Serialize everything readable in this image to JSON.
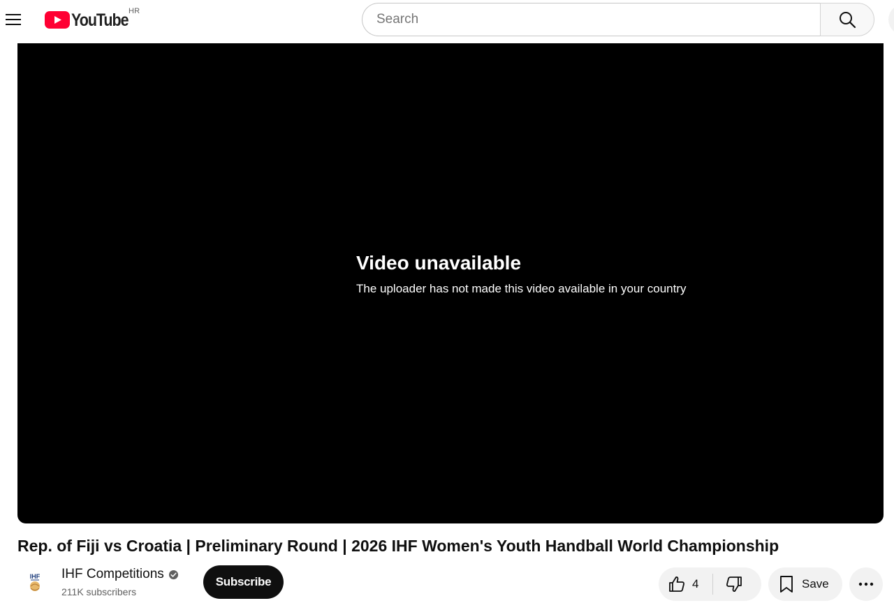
{
  "masthead": {
    "menu_icon": "hamburger-menu-icon",
    "logo_text": "YouTube",
    "logo_region": "HR",
    "logo_color": "#ff0033",
    "search_placeholder": "Search",
    "search_icon": "search-icon"
  },
  "player": {
    "error_title": "Video unavailable",
    "error_subtitle": "The uploader has not made this video available in your country"
  },
  "video": {
    "title": "Rep. of Fiji vs Croatia | Preliminary Round | 2026 IHF Women's Youth Handball World Championship"
  },
  "owner": {
    "channel_name": "IHF Competitions",
    "verified_icon": "verified-check-icon",
    "subscribers": "211K subscribers",
    "subscribe_label": "Subscribe",
    "avatar_text": "IHF"
  },
  "actions": {
    "like_icon": "thumbs-up-icon",
    "like_count": "4",
    "dislike_icon": "thumbs-down-icon",
    "save_icon": "bookmark-icon",
    "save_label": "Save",
    "more_icon": "more-horizontal-icon"
  }
}
